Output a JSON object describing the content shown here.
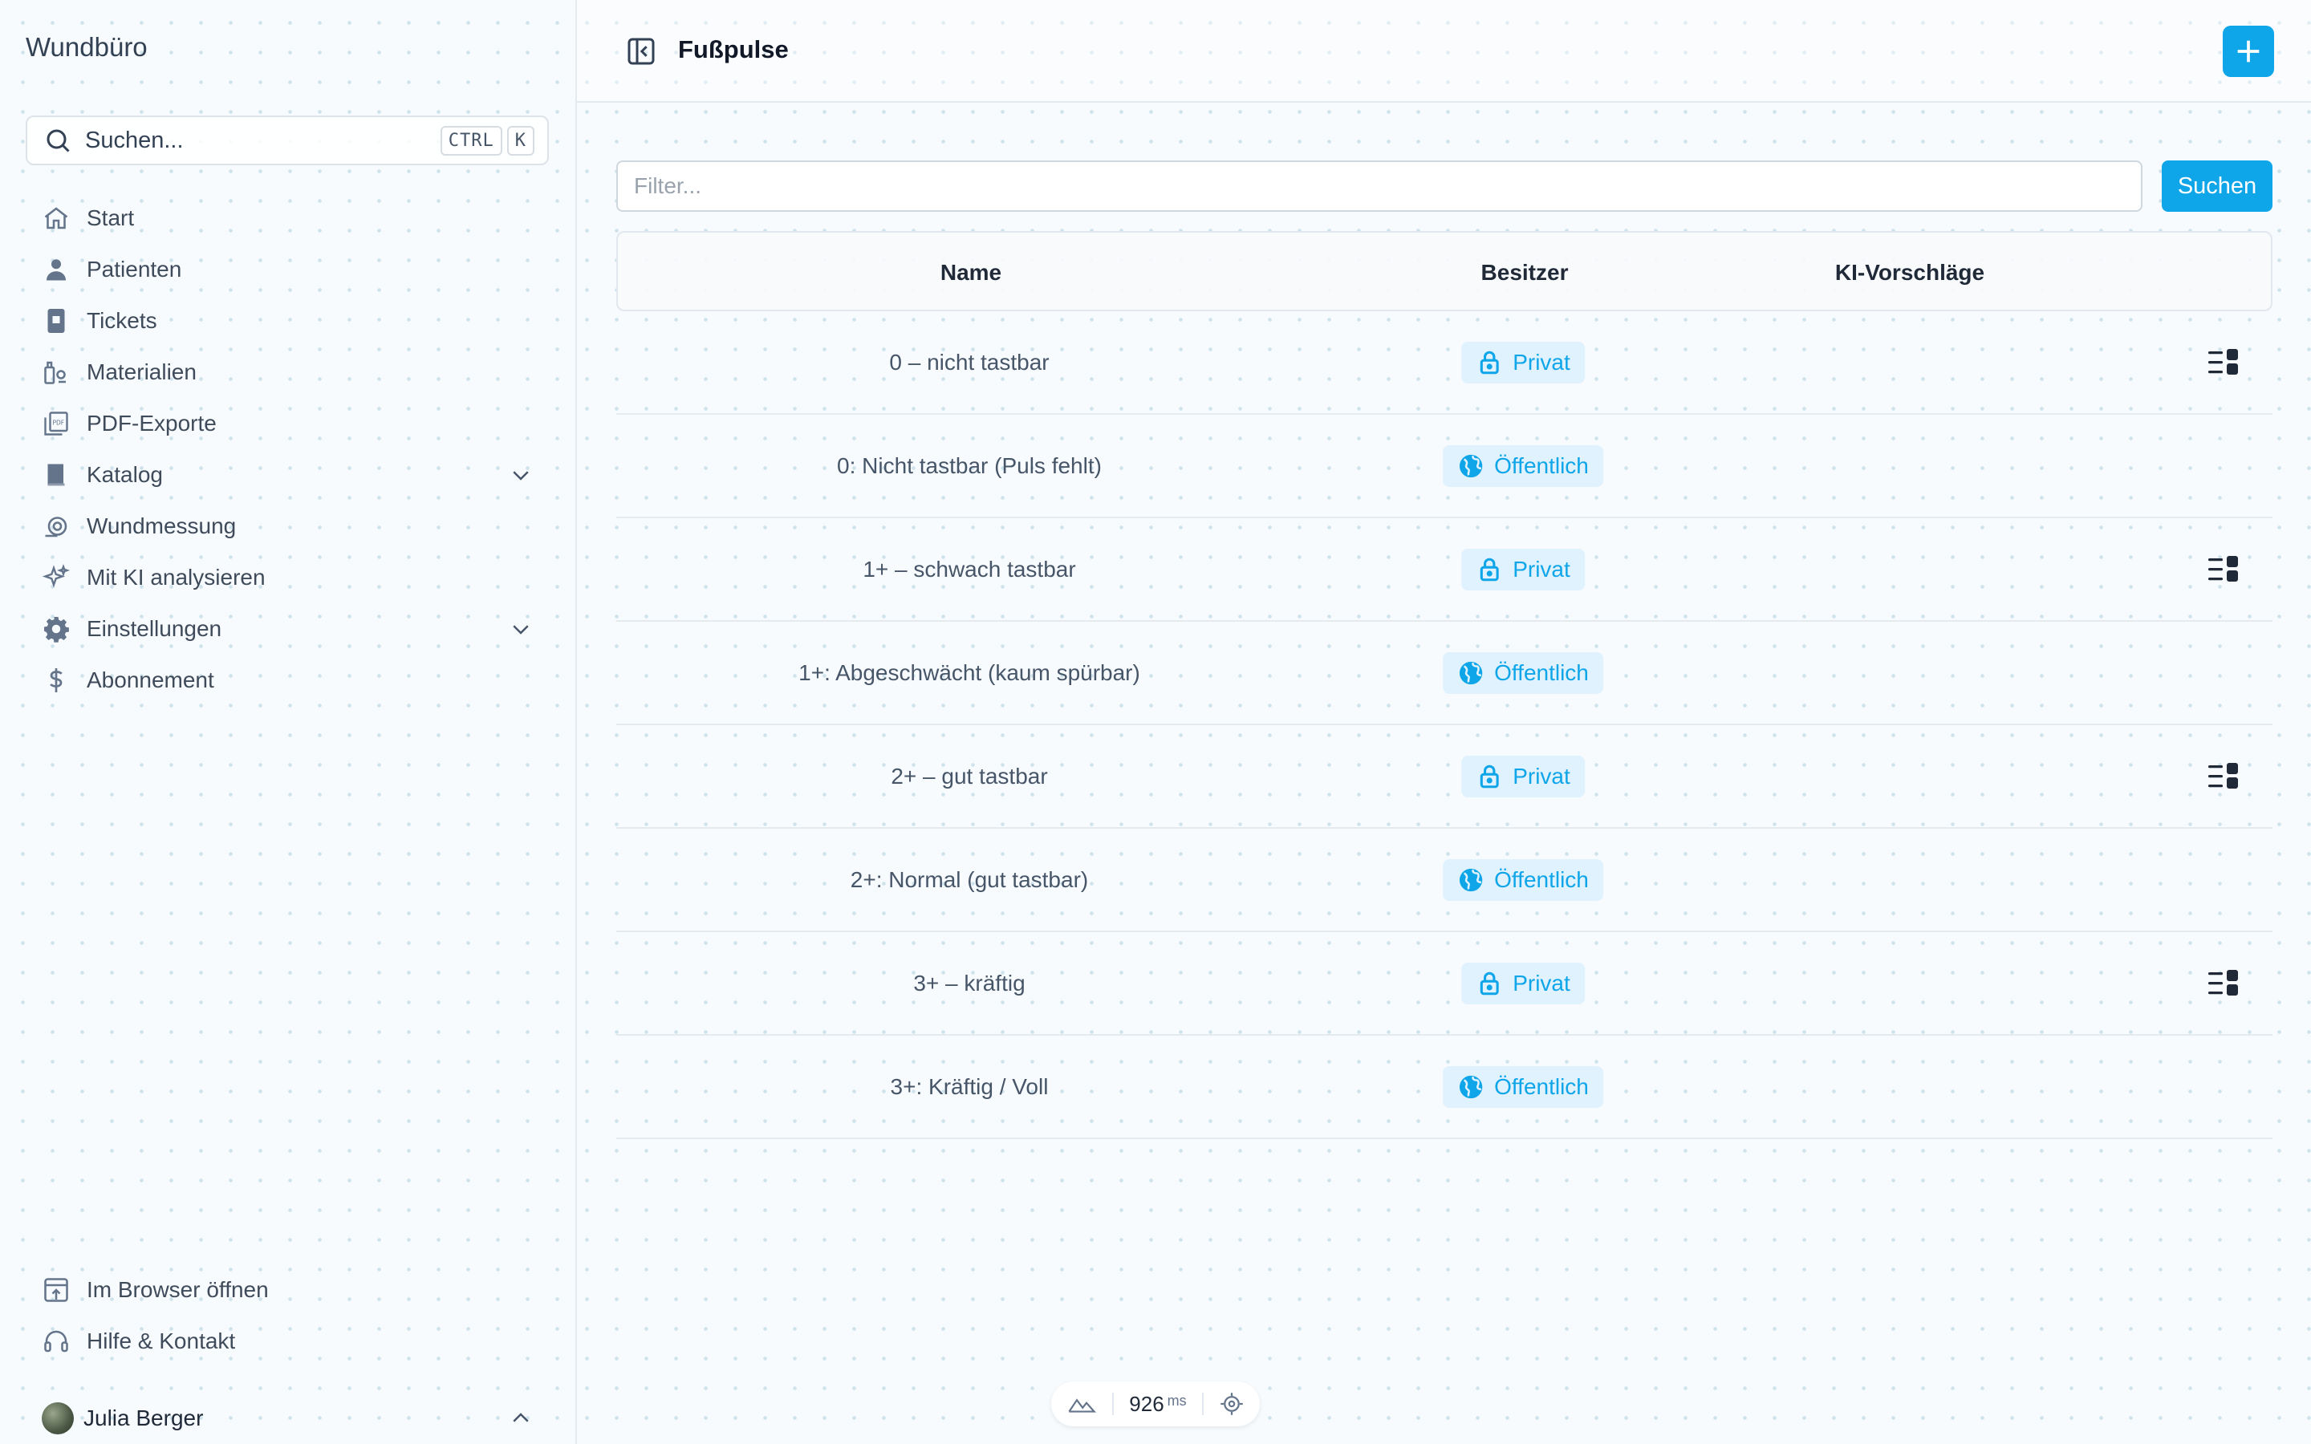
{
  "app": {
    "brand": "Wundbüro"
  },
  "sidebar": {
    "search": {
      "placeholder": "Suchen...",
      "kbd": [
        "CTRL",
        "K"
      ]
    },
    "items": [
      {
        "label": "Start",
        "icon": "home-icon"
      },
      {
        "label": "Patienten",
        "icon": "user-icon"
      },
      {
        "label": "Tickets",
        "icon": "ticket-icon"
      },
      {
        "label": "Materialien",
        "icon": "materials-icon"
      },
      {
        "label": "PDF-Exporte",
        "icon": "pdf-icon"
      },
      {
        "label": "Katalog",
        "icon": "book-icon",
        "expandable": true
      },
      {
        "label": "Wundmessung",
        "icon": "measure-icon"
      },
      {
        "label": "Mit KI analysieren",
        "icon": "sparkle-icon"
      },
      {
        "label": "Einstellungen",
        "icon": "gear-icon",
        "expandable": true
      },
      {
        "label": "Abonnement",
        "icon": "dollar-icon"
      }
    ],
    "bottom_items": [
      {
        "label": "Im Browser öffnen",
        "icon": "open-browser-icon"
      },
      {
        "label": "Hilfe & Kontakt",
        "icon": "headset-icon"
      }
    ],
    "user": {
      "name": "Julia Berger"
    }
  },
  "header": {
    "title": "Fußpulse"
  },
  "filter": {
    "placeholder": "Filter...",
    "value": "",
    "button_label": "Suchen"
  },
  "table": {
    "columns": [
      "Name",
      "Besitzer",
      "KI-Vorschläge"
    ],
    "rows": [
      {
        "name": "0 – nicht tastbar",
        "owner": "Privat",
        "owner_type": "private",
        "has_action": true
      },
      {
        "name": "0: Nicht tastbar (Puls fehlt)",
        "owner": "Öffentlich",
        "owner_type": "public",
        "has_action": false
      },
      {
        "name": "1+ – schwach tastbar",
        "owner": "Privat",
        "owner_type": "private",
        "has_action": true
      },
      {
        "name": "1+: Abgeschwächt (kaum spürbar)",
        "owner": "Öffentlich",
        "owner_type": "public",
        "has_action": false
      },
      {
        "name": "2+ – gut tastbar",
        "owner": "Privat",
        "owner_type": "private",
        "has_action": true
      },
      {
        "name": "2+: Normal (gut tastbar)",
        "owner": "Öffentlich",
        "owner_type": "public",
        "has_action": false
      },
      {
        "name": "3+ – kräftig",
        "owner": "Privat",
        "owner_type": "private",
        "has_action": true
      },
      {
        "name": "3+: Kräftig / Voll",
        "owner": "Öffentlich",
        "owner_type": "public",
        "has_action": false
      }
    ]
  },
  "perf": {
    "value": "926",
    "unit": "ms"
  },
  "colors": {
    "accent": "#0ea5e9",
    "badge_bg": "#e0f2fe"
  }
}
